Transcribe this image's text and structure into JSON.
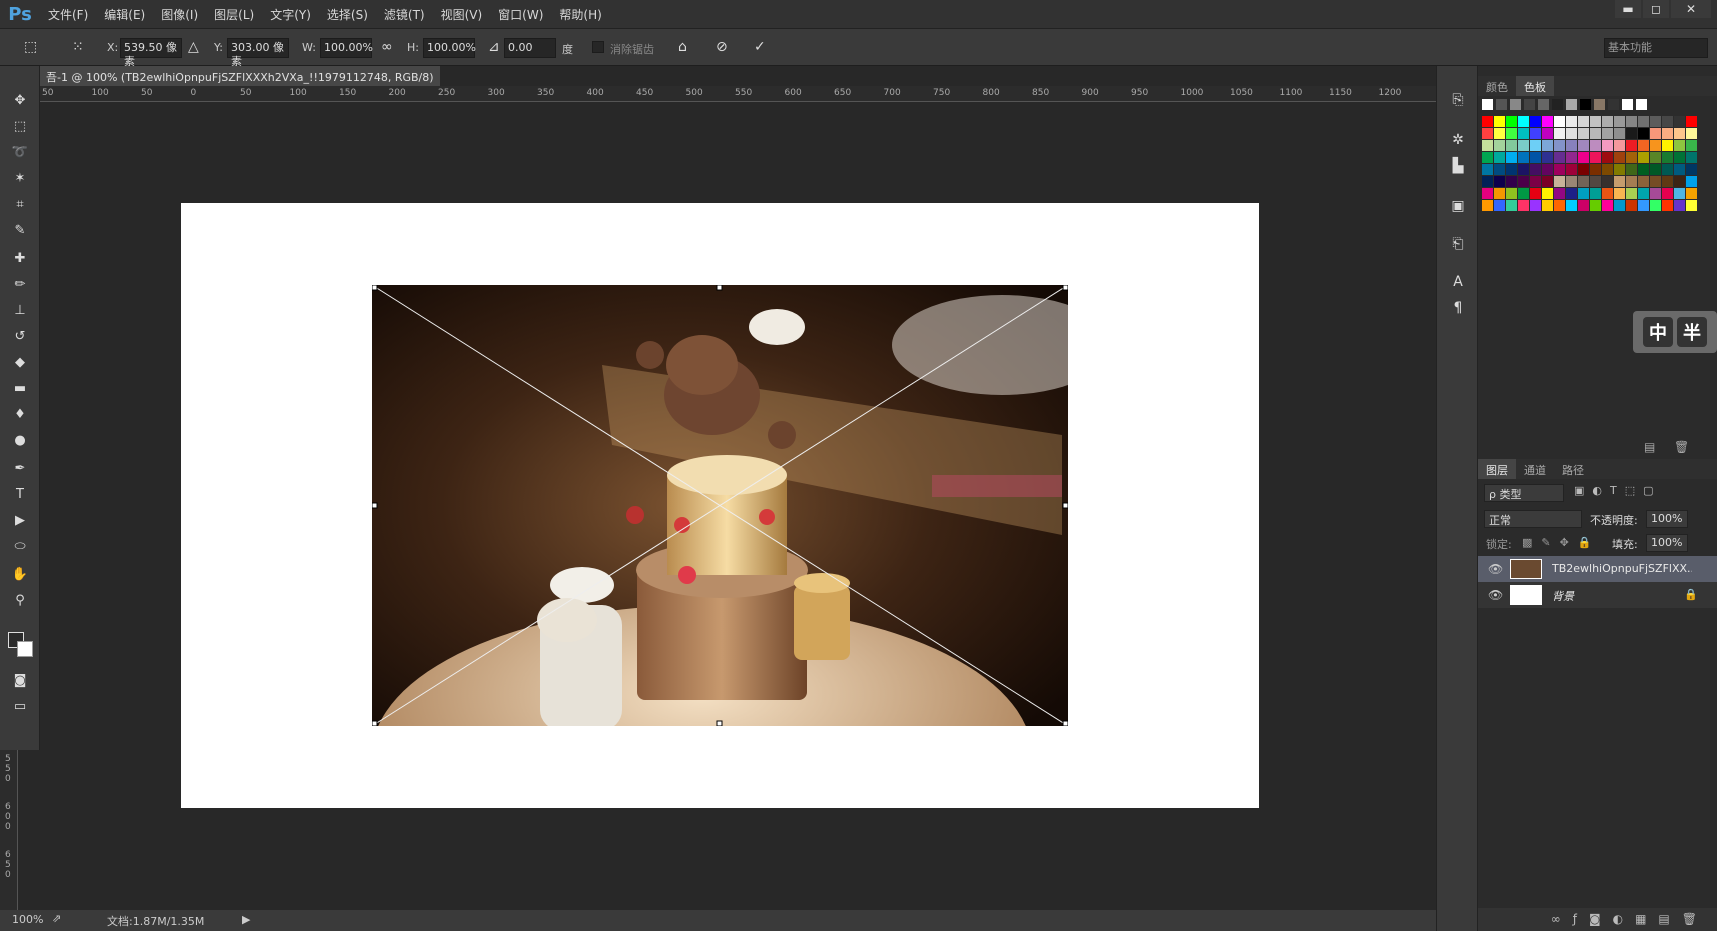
{
  "app": {
    "logo": "Ps"
  },
  "menu": [
    "文件(F)",
    "编辑(E)",
    "图像(I)",
    "图层(L)",
    "文字(Y)",
    "选择(S)",
    "滤镜(T)",
    "视图(V)",
    "窗口(W)",
    "帮助(H)"
  ],
  "window_controls": {
    "minimize": "▬",
    "maximize": "◻",
    "close": "✕"
  },
  "options": {
    "x_label": "X:",
    "x_value": "539.50 像素",
    "y_label": "Y:",
    "y_value": "303.00 像素",
    "w_label": "W:",
    "w_value": "100.00%",
    "h_label": "H:",
    "h_value": "100.00%",
    "angle_value": "0.00",
    "angle_unit": "度",
    "antialias_label": "消除锯齿",
    "workspace_value": "基本功能"
  },
  "document": {
    "tab_title": "吾-1 @ 100% (TB2ewlhiOpnpuFjSZFlXXXh2VXa_!!1979112748, RGB/8)",
    "tab_close": "×",
    "ruler_ticks": [
      "50",
      "100",
      "50",
      "0",
      "50",
      "100",
      "150",
      "200",
      "250",
      "300",
      "350",
      "400",
      "450",
      "500",
      "550",
      "600",
      "650",
      "700",
      "750",
      "800",
      "850",
      "900",
      "950",
      "1000",
      "1050",
      "1100",
      "1150",
      "1200"
    ],
    "vruler_ticks": [
      "5",
      "5",
      "0",
      "6",
      "0",
      "0",
      "6",
      "5",
      "0"
    ]
  },
  "status": {
    "zoom": "100%",
    "doc_info": "文档:1.87M/1.35M"
  },
  "swatch_panel": {
    "tabs": [
      "颜色",
      "色板"
    ],
    "active_tab": "色板",
    "colors": [
      "#ff0000",
      "#ffff00",
      "#00ff00",
      "#00ffff",
      "#0000ff",
      "#ff00ff",
      "#ffffff",
      "#ebebeb",
      "#d6d6d6",
      "#c2c2c2",
      "#adadad",
      "#999999",
      "#858585",
      "#707070",
      "#5c5c5c",
      "#474747",
      "#333333",
      "#ff0000",
      "#ff4040",
      "#ffff40",
      "#40ff40",
      "#00c0c0",
      "#4040ff",
      "#c000c0",
      "#f0f0f0",
      "#e0e0e0",
      "#cccccc",
      "#b8b8b8",
      "#a3a3a3",
      "#8f8f8f",
      "#1a1a1a",
      "#000000",
      "#f7977a",
      "#fbad82",
      "#fdc68c",
      "#fff799",
      "#c4df9b",
      "#a3d39c",
      "#82ca9c",
      "#7accc8",
      "#6dcff6",
      "#7da7d9",
      "#8393ca",
      "#8781bd",
      "#a187be",
      "#bd8cbf",
      "#f49ac1",
      "#f5989d",
      "#ed1c24",
      "#f26522",
      "#f7941d",
      "#fff200",
      "#8dc63f",
      "#39b54a",
      "#00a651",
      "#00a99d",
      "#00aeef",
      "#0072bc",
      "#0054a6",
      "#2e3192",
      "#662d91",
      "#92278f",
      "#ec008c",
      "#ed145b",
      "#9e0b0f",
      "#a0410d",
      "#a36209",
      "#aba000",
      "#598527",
      "#197b30",
      "#007236",
      "#00746b",
      "#0076a3",
      "#004b80",
      "#003471",
      "#1b1464",
      "#440e62",
      "#630460",
      "#9e005d",
      "#9e0039",
      "#790000",
      "#7b2e00",
      "#7d4900",
      "#827b00",
      "#406618",
      "#005e20",
      "#005826",
      "#005952",
      "#005b7f",
      "#003663",
      "#002157",
      "#0d004c",
      "#32004b",
      "#4b0049",
      "#7b0046",
      "#7a0026",
      "#c7b299",
      "#998675",
      "#736357",
      "#534741",
      "#37302d",
      "#c69c6d",
      "#a67c52",
      "#8c6239",
      "#754c24",
      "#603913",
      "#3c2415",
      "#00a0e9",
      "#e4007f",
      "#f39800",
      "#8fc31f",
      "#009944",
      "#e60012",
      "#fff100",
      "#920783",
      "#1d2088",
      "#00a0c1",
      "#009e96",
      "#ea5514",
      "#f8b551",
      "#aacf52",
      "#00a6ad",
      "#a64a97",
      "#e5004f",
      "#4eb5e5",
      "#f5a200",
      "#ff9900",
      "#3366ff",
      "#33cc99",
      "#ff3366",
      "#9933ff",
      "#ffcc00",
      "#ff6600",
      "#00ccff",
      "#cc0066",
      "#66cc00",
      "#ff0099",
      "#0099cc",
      "#cc3300",
      "#3399ff",
      "#33ff66",
      "#ff3300",
      "#6633cc",
      "#ffff33"
    ]
  },
  "layers_panel": {
    "tabs": [
      "图层",
      "通道",
      "路径"
    ],
    "active_tab": "图层",
    "filter_label": "ρ 类型",
    "blend_mode": "正常",
    "opacity_label": "不透明度:",
    "opacity_value": "100%",
    "lock_label": "锁定:",
    "fill_label": "填充:",
    "fill_value": "100%",
    "layers": [
      {
        "name": "TB2ewlhiOpnpuFjSZFlXX...",
        "selected": true
      },
      {
        "name": "背景",
        "selected": false
      }
    ]
  },
  "ime": {
    "key1": "中",
    "key2": "半"
  }
}
